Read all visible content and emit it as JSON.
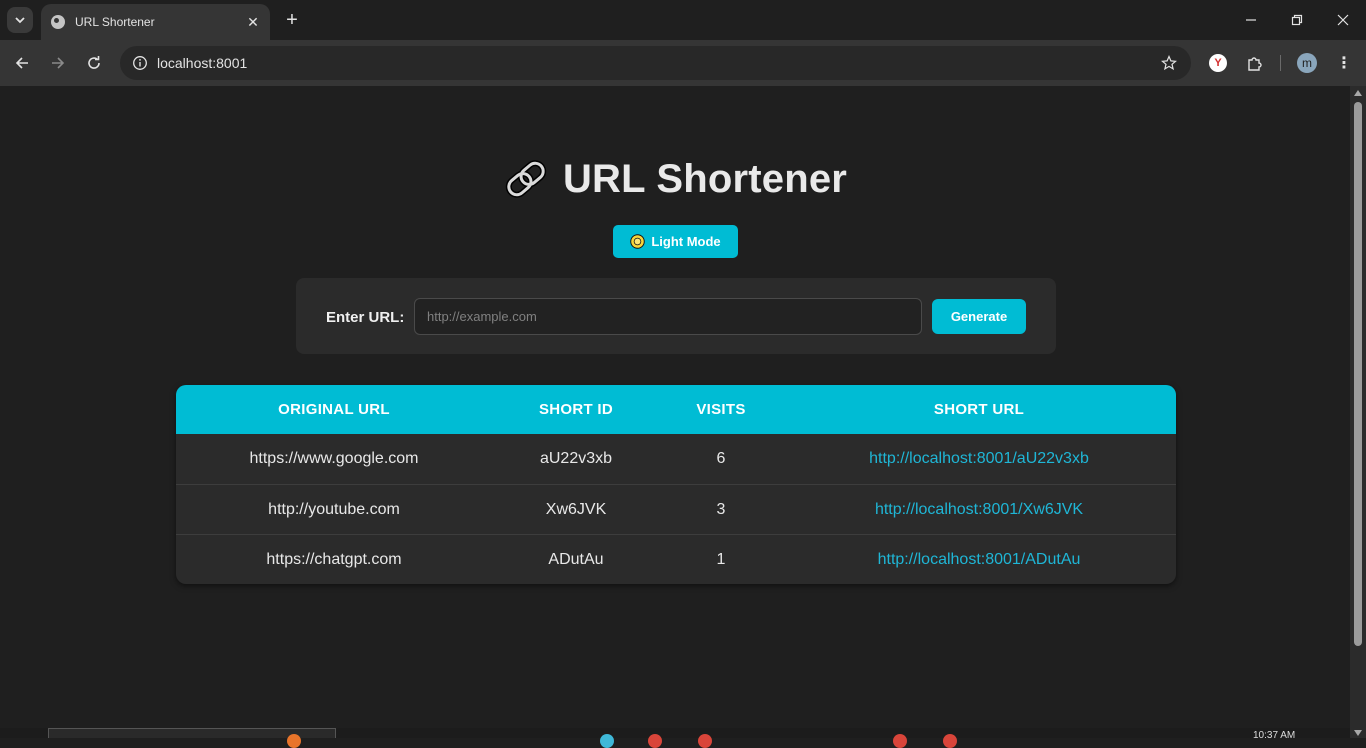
{
  "browser": {
    "tab_title": "URL Shortener",
    "address": "localhost:8001",
    "extension_badge": "Y",
    "profile_initial": "m"
  },
  "page": {
    "heading": "URL Shortener",
    "mode_button": "Light Mode",
    "form": {
      "label": "Enter URL:",
      "placeholder": "http://example.com",
      "value": "",
      "submit": "Generate"
    },
    "table": {
      "headers": [
        "ORIGINAL URL",
        "SHORT ID",
        "VISITS",
        "SHORT URL"
      ],
      "rows": [
        {
          "original": "https://www.google.com",
          "short_id": "aU22v3xb",
          "visits": "6",
          "short_url": "http://localhost:8001/aU22v3xb"
        },
        {
          "original": "http://youtube.com",
          "short_id": "Xw6JVK",
          "visits": "3",
          "short_url": "http://localhost:8001/Xw6JVK"
        },
        {
          "original": "https://chatgpt.com",
          "short_id": "ADutAu",
          "visits": "1",
          "short_url": "http://localhost:8001/ADutAu"
        }
      ]
    }
  },
  "taskbar": {
    "clock": "10:37 AM"
  },
  "colors": {
    "accent": "#00bcd4",
    "link": "#1fb6d6",
    "background": "#1f1f1f",
    "card": "#2b2b2b"
  }
}
